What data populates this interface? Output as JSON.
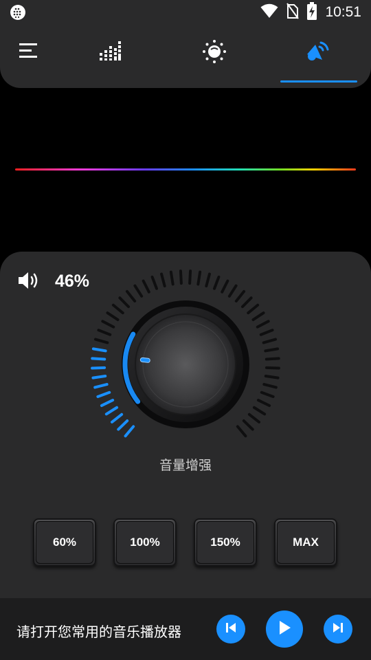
{
  "status_bar": {
    "time": "10:51",
    "icons": [
      "app-notification-icon",
      "wifi-icon",
      "no-sim-icon",
      "battery-charging-icon"
    ]
  },
  "nav": {
    "tabs": [
      {
        "icon": "menu-icon",
        "active": false
      },
      {
        "icon": "equalizer-icon",
        "active": false
      },
      {
        "icon": "effects-icon",
        "active": false
      },
      {
        "icon": "volume-boost-icon",
        "active": true
      }
    ],
    "accent_color": "#1a90ff"
  },
  "volume": {
    "percent_label": "46%",
    "level": 0.46,
    "knob_label": "音量增强"
  },
  "presets": [
    {
      "label": "60%"
    },
    {
      "label": "100%"
    },
    {
      "label": "150%"
    },
    {
      "label": "MAX"
    }
  ],
  "player": {
    "message": "请打开您常用的音乐播放器",
    "controls": [
      "previous-icon",
      "play-icon",
      "next-icon"
    ]
  }
}
